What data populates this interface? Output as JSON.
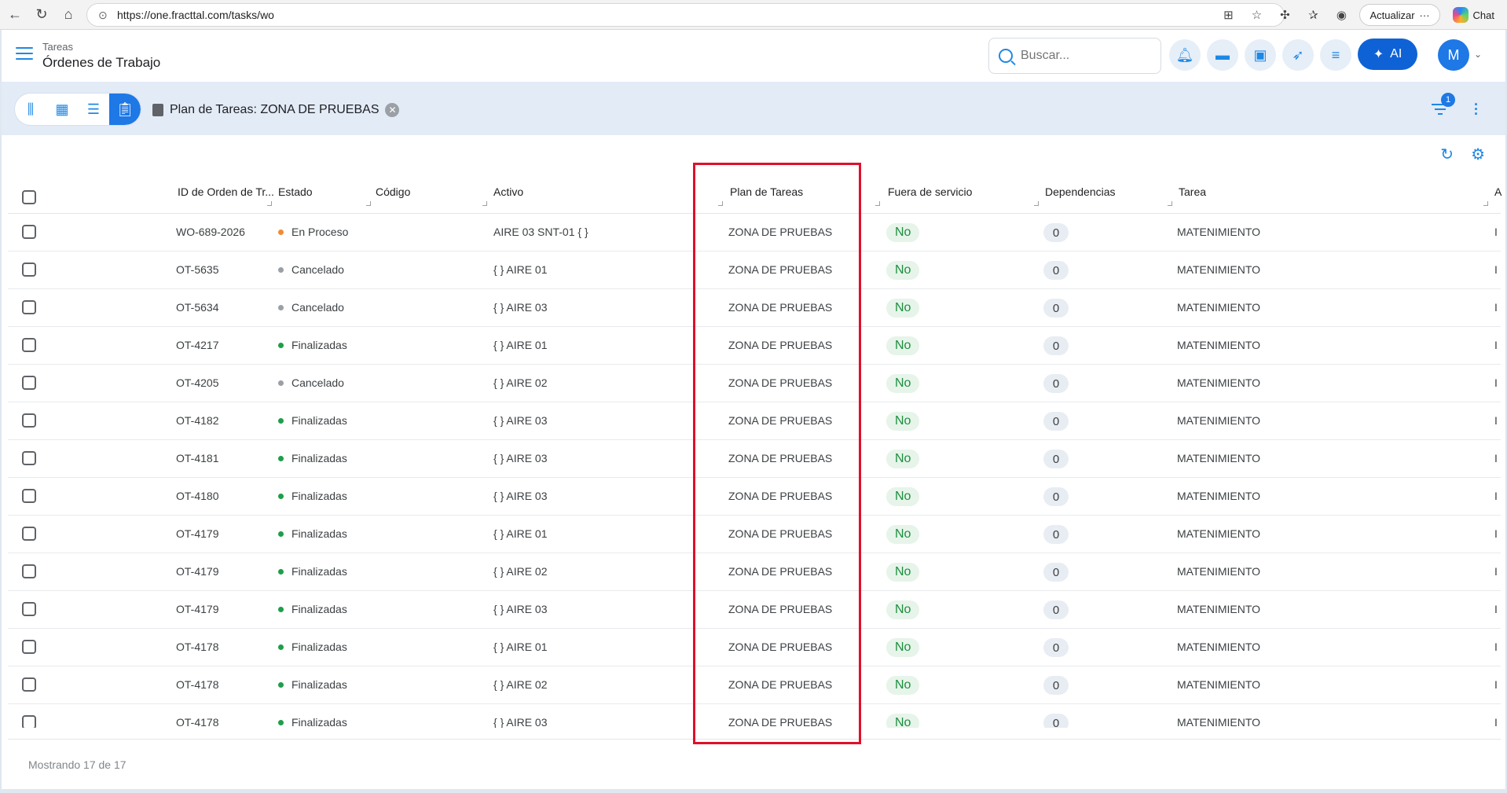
{
  "browser": {
    "url": "https://one.fracttal.com/tasks/wo",
    "update_label": "Actualizar",
    "chat_label": "Chat"
  },
  "header": {
    "breadcrumb": "Tareas",
    "title": "Órdenes de Trabajo",
    "search_placeholder": "Buscar...",
    "ai_label": "AI",
    "avatar_initial": "M"
  },
  "toolbar": {
    "filter_chip_label": "Plan de Tareas: ZONA DE PRUEBAS",
    "filter_count": "1"
  },
  "table": {
    "columns": [
      "ID de Orden de Tr...",
      "Estado",
      "Código",
      "Activo",
      "Plan de Tareas",
      "Fuera de servicio",
      "Dependencias",
      "Tarea",
      "A"
    ],
    "rows": [
      {
        "id": "WO-689-2026",
        "status": "En Proceso",
        "status_color": "#f28b30",
        "code": "",
        "asset": "AIRE 03 SNT-01 { }",
        "plan": "ZONA DE PRUEBAS",
        "out_of_service": "No",
        "deps": "0",
        "task": "MATENIMIENTO",
        "extra": "I"
      },
      {
        "id": "OT-5635",
        "status": "Cancelado",
        "status_color": "#9aa0a6",
        "code": "",
        "asset": "{ } AIRE 01",
        "plan": "ZONA DE PRUEBAS",
        "out_of_service": "No",
        "deps": "0",
        "task": "MATENIMIENTO",
        "extra": "I"
      },
      {
        "id": "OT-5634",
        "status": "Cancelado",
        "status_color": "#9aa0a6",
        "code": "",
        "asset": "{ } AIRE 03",
        "plan": "ZONA DE PRUEBAS",
        "out_of_service": "No",
        "deps": "0",
        "task": "MATENIMIENTO",
        "extra": "I"
      },
      {
        "id": "OT-4217",
        "status": "Finalizadas",
        "status_color": "#1e9e4a",
        "code": "",
        "asset": "{ } AIRE 01",
        "plan": "ZONA DE PRUEBAS",
        "out_of_service": "No",
        "deps": "0",
        "task": "MATENIMIENTO",
        "extra": "I"
      },
      {
        "id": "OT-4205",
        "status": "Cancelado",
        "status_color": "#9aa0a6",
        "code": "",
        "asset": "{ } AIRE 02",
        "plan": "ZONA DE PRUEBAS",
        "out_of_service": "No",
        "deps": "0",
        "task": "MATENIMIENTO",
        "extra": "I"
      },
      {
        "id": "OT-4182",
        "status": "Finalizadas",
        "status_color": "#1e9e4a",
        "code": "",
        "asset": "{ } AIRE 03",
        "plan": "ZONA DE PRUEBAS",
        "out_of_service": "No",
        "deps": "0",
        "task": "MATENIMIENTO",
        "extra": "I"
      },
      {
        "id": "OT-4181",
        "status": "Finalizadas",
        "status_color": "#1e9e4a",
        "code": "",
        "asset": "{ } AIRE 03",
        "plan": "ZONA DE PRUEBAS",
        "out_of_service": "No",
        "deps": "0",
        "task": "MATENIMIENTO",
        "extra": "I"
      },
      {
        "id": "OT-4180",
        "status": "Finalizadas",
        "status_color": "#1e9e4a",
        "code": "",
        "asset": "{ } AIRE 03",
        "plan": "ZONA DE PRUEBAS",
        "out_of_service": "No",
        "deps": "0",
        "task": "MATENIMIENTO",
        "extra": "I"
      },
      {
        "id": "OT-4179",
        "status": "Finalizadas",
        "status_color": "#1e9e4a",
        "code": "",
        "asset": "{ } AIRE 01",
        "plan": "ZONA DE PRUEBAS",
        "out_of_service": "No",
        "deps": "0",
        "task": "MATENIMIENTO",
        "extra": "I"
      },
      {
        "id": "OT-4179",
        "status": "Finalizadas",
        "status_color": "#1e9e4a",
        "code": "",
        "asset": "{ } AIRE 02",
        "plan": "ZONA DE PRUEBAS",
        "out_of_service": "No",
        "deps": "0",
        "task": "MATENIMIENTO",
        "extra": "I"
      },
      {
        "id": "OT-4179",
        "status": "Finalizadas",
        "status_color": "#1e9e4a",
        "code": "",
        "asset": "{ } AIRE 03",
        "plan": "ZONA DE PRUEBAS",
        "out_of_service": "No",
        "deps": "0",
        "task": "MATENIMIENTO",
        "extra": "I"
      },
      {
        "id": "OT-4178",
        "status": "Finalizadas",
        "status_color": "#1e9e4a",
        "code": "",
        "asset": "{ } AIRE 01",
        "plan": "ZONA DE PRUEBAS",
        "out_of_service": "No",
        "deps": "0",
        "task": "MATENIMIENTO",
        "extra": "I"
      },
      {
        "id": "OT-4178",
        "status": "Finalizadas",
        "status_color": "#1e9e4a",
        "code": "",
        "asset": "{ } AIRE 02",
        "plan": "ZONA DE PRUEBAS",
        "out_of_service": "No",
        "deps": "0",
        "task": "MATENIMIENTO",
        "extra": "I"
      },
      {
        "id": "OT-4178",
        "status": "Finalizadas",
        "status_color": "#1e9e4a",
        "code": "",
        "asset": "{ } AIRE 03",
        "plan": "ZONA DE PRUEBAS",
        "out_of_service": "No",
        "deps": "0",
        "task": "MATENIMIENTO",
        "extra": "I"
      }
    ]
  },
  "footer": {
    "showing": "Mostrando 17 de 17"
  },
  "colors": {
    "accent": "#1e78e6",
    "highlight": "#e0102b",
    "toolbar_bg": "#e3ebf7"
  }
}
